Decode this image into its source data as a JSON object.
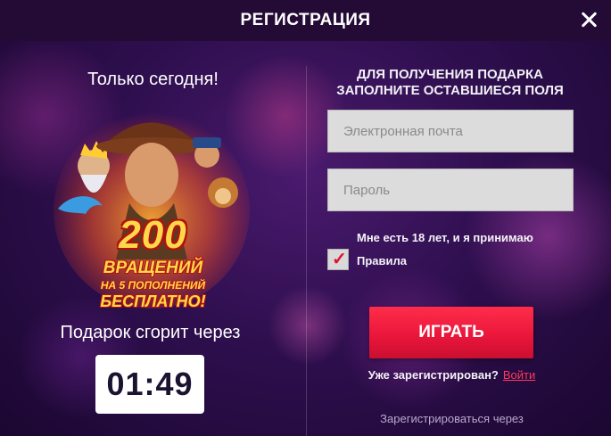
{
  "header": {
    "title": "РЕГИСТРАЦИЯ"
  },
  "promo": {
    "title": "Только сегодня!",
    "bonus_count": "200",
    "bonus_line2": "ВРАЩЕНИЙ",
    "bonus_line3": "НА 5 ПОПОЛНЕНИЙ",
    "bonus_line4": "БЕСПЛАТНО!",
    "expires_label": "Подарок сгорит через",
    "timer": "01:49"
  },
  "form": {
    "title_line1": "ДЛЯ ПОЛУЧЕНИЯ ПОДАРКА",
    "title_line2": "ЗАПОЛНИТЕ ОСТАВШИЕСЯ ПОЛЯ",
    "email_placeholder": "Электронная почта",
    "email_value": "",
    "password_placeholder": "Пароль",
    "password_value": "",
    "agree_text": "Мне есть 18 лет, и я принимаю",
    "rules_label": "Правила",
    "checkbox_checked": true,
    "checkmark": "✓",
    "play_label": "ИГРАТЬ",
    "already_text": "Уже зарегистрирован?",
    "login_label": "Войти",
    "register_via": "Зарегистрироваться через"
  },
  "colors": {
    "accent": "#e8153a",
    "link": "#ff3b5c",
    "header_bg": "#240b36",
    "bonus_yellow": "#ffd84a"
  }
}
